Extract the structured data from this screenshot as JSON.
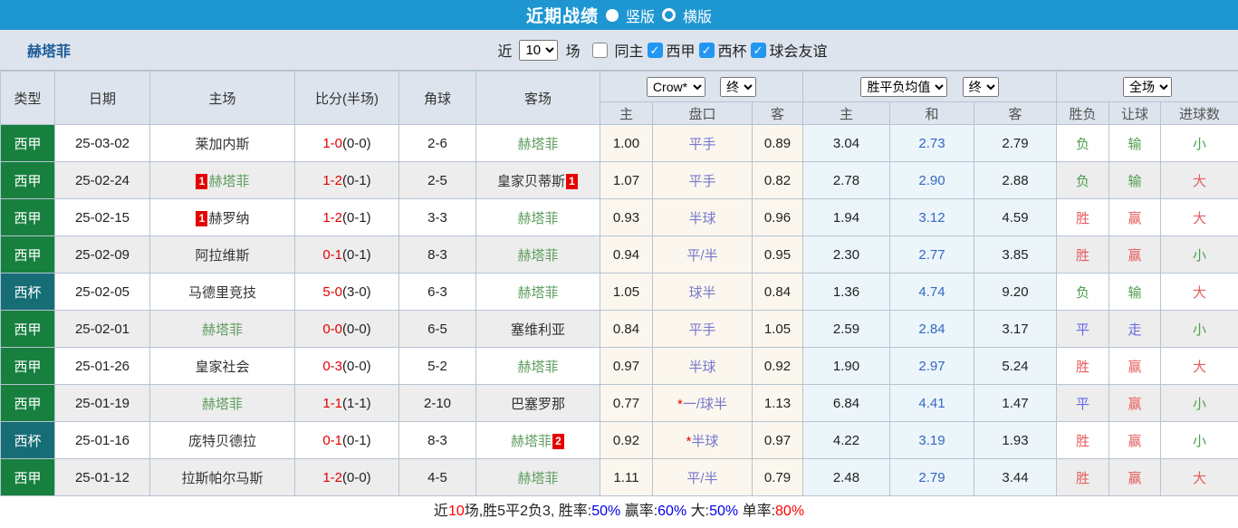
{
  "colors": {
    "topbar": "#1e96d2",
    "headerbg": "#dde4ed",
    "border": "#b6c3d1",
    "teamtitle": "#1f5c99",
    "laliga": "#17803f",
    "cup": "#166d76",
    "teamgreen": "#5f9e60",
    "scorered": "#e60000",
    "handicap": "#7777cc",
    "avgblue": "#3468c0",
    "resred": "#e85c5c",
    "resgreen": "#4f9e4f",
    "resblue": "#6666e6",
    "roweven": "#ededed",
    "oddsbg": "#fbf7ee",
    "avgbg": "#ecf5fa",
    "pctblue": "#0000e6",
    "footred": "#ff0000",
    "check": "#2196f3"
  },
  "topbar": {
    "title": "近期战绩",
    "radio_vertical": "竖版",
    "radio_horizontal": "横版",
    "selected": "竖版"
  },
  "filter": {
    "team": "赫塔菲",
    "recent_label": "近",
    "recent_value": "10",
    "matches_label": "场",
    "same_home_label": "同主",
    "same_home_checked": false,
    "leagues": [
      {
        "label": "西甲",
        "checked": true
      },
      {
        "label": "西杯",
        "checked": true
      },
      {
        "label": "球会友谊",
        "checked": true
      }
    ]
  },
  "table": {
    "left_headers": [
      "类型",
      "日期",
      "主场",
      "比分(半场)",
      "角球",
      "客场"
    ],
    "sub_headers": [
      "主",
      "盘口",
      "客",
      "主",
      "和",
      "客",
      "胜负",
      "让球",
      "进球数"
    ],
    "bookmaker_select": "Crow*",
    "bookmaker_time_select": "终",
    "avg_select": "胜平负均值",
    "avg_time_select": "终",
    "scope_select": "全场"
  },
  "rows": [
    {
      "league": "西甲",
      "league_style": "laliga",
      "date": "25-03-02",
      "home": {
        "name": "莱加内斯",
        "green": false
      },
      "ft": "1-0",
      "ht": "(0-0)",
      "corner": "2-6",
      "away": {
        "name": "赫塔菲",
        "green": true
      },
      "crown": [
        "1.00",
        "平手",
        "0.89"
      ],
      "avg": [
        "3.04",
        "2.73",
        "2.79"
      ],
      "results": [
        {
          "t": "负",
          "c": "green"
        },
        {
          "t": "输",
          "c": "green"
        },
        {
          "t": "小",
          "c": "green"
        }
      ]
    },
    {
      "league": "西甲",
      "league_style": "laliga",
      "date": "25-02-24",
      "home": {
        "name": "赫塔菲",
        "green": true,
        "badge_before": "1"
      },
      "ft": "1-2",
      "ht": "(0-1)",
      "corner": "2-5",
      "away": {
        "name": "皇家贝蒂斯",
        "green": false,
        "badge_after": "1"
      },
      "crown": [
        "1.07",
        "平手",
        "0.82"
      ],
      "avg": [
        "2.78",
        "2.90",
        "2.88"
      ],
      "results": [
        {
          "t": "负",
          "c": "green"
        },
        {
          "t": "输",
          "c": "green"
        },
        {
          "t": "大",
          "c": "red"
        }
      ]
    },
    {
      "league": "西甲",
      "league_style": "laliga",
      "date": "25-02-15",
      "home": {
        "name": "赫罗纳",
        "green": false,
        "badge_before": "1"
      },
      "ft": "1-2",
      "ht": "(0-1)",
      "corner": "3-3",
      "away": {
        "name": "赫塔菲",
        "green": true
      },
      "crown": [
        "0.93",
        "半球",
        "0.96"
      ],
      "avg": [
        "1.94",
        "3.12",
        "4.59"
      ],
      "results": [
        {
          "t": "胜",
          "c": "red"
        },
        {
          "t": "赢",
          "c": "red"
        },
        {
          "t": "大",
          "c": "red"
        }
      ]
    },
    {
      "league": "西甲",
      "league_style": "laliga",
      "date": "25-02-09",
      "home": {
        "name": "阿拉维斯",
        "green": false
      },
      "ft": "0-1",
      "ht": "(0-1)",
      "corner": "8-3",
      "away": {
        "name": "赫塔菲",
        "green": true
      },
      "crown": [
        "0.94",
        "平/半",
        "0.95"
      ],
      "avg": [
        "2.30",
        "2.77",
        "3.85"
      ],
      "results": [
        {
          "t": "胜",
          "c": "red"
        },
        {
          "t": "赢",
          "c": "red"
        },
        {
          "t": "小",
          "c": "green"
        }
      ]
    },
    {
      "league": "西杯",
      "league_style": "cup",
      "date": "25-02-05",
      "home": {
        "name": "马德里竞技",
        "green": false
      },
      "ft": "5-0",
      "ht": "(3-0)",
      "corner": "6-3",
      "away": {
        "name": "赫塔菲",
        "green": true
      },
      "crown": [
        "1.05",
        "球半",
        "0.84"
      ],
      "avg": [
        "1.36",
        "4.74",
        "9.20"
      ],
      "results": [
        {
          "t": "负",
          "c": "green"
        },
        {
          "t": "输",
          "c": "green"
        },
        {
          "t": "大",
          "c": "red"
        }
      ]
    },
    {
      "league": "西甲",
      "league_style": "laliga",
      "date": "25-02-01",
      "home": {
        "name": "赫塔菲",
        "green": true
      },
      "ft": "0-0",
      "ht": "(0-0)",
      "corner": "6-5",
      "away": {
        "name": "塞维利亚",
        "green": false
      },
      "crown": [
        "0.84",
        "平手",
        "1.05"
      ],
      "avg": [
        "2.59",
        "2.84",
        "3.17"
      ],
      "results": [
        {
          "t": "平",
          "c": "blue"
        },
        {
          "t": "走",
          "c": "blue"
        },
        {
          "t": "小",
          "c": "green"
        }
      ]
    },
    {
      "league": "西甲",
      "league_style": "laliga",
      "date": "25-01-26",
      "home": {
        "name": "皇家社会",
        "green": false
      },
      "ft": "0-3",
      "ht": "(0-0)",
      "corner": "5-2",
      "away": {
        "name": "赫塔菲",
        "green": true
      },
      "crown": [
        "0.97",
        "半球",
        "0.92"
      ],
      "avg": [
        "1.90",
        "2.97",
        "5.24"
      ],
      "results": [
        {
          "t": "胜",
          "c": "red"
        },
        {
          "t": "赢",
          "c": "red"
        },
        {
          "t": "大",
          "c": "red"
        }
      ]
    },
    {
      "league": "西甲",
      "league_style": "laliga",
      "date": "25-01-19",
      "home": {
        "name": "赫塔菲",
        "green": true
      },
      "ft": "1-1",
      "ht": "(1-1)",
      "corner": "2-10",
      "away": {
        "name": "巴塞罗那",
        "green": false
      },
      "crown": [
        "0.77",
        "*一/球半",
        "1.13"
      ],
      "avg": [
        "6.84",
        "4.41",
        "1.47"
      ],
      "results": [
        {
          "t": "平",
          "c": "blue"
        },
        {
          "t": "赢",
          "c": "red"
        },
        {
          "t": "小",
          "c": "green"
        }
      ]
    },
    {
      "league": "西杯",
      "league_style": "cup",
      "date": "25-01-16",
      "home": {
        "name": "庞特贝德拉",
        "green": false
      },
      "ft": "0-1",
      "ht": "(0-1)",
      "corner": "8-3",
      "away": {
        "name": "赫塔菲",
        "green": true,
        "badge_after": "2"
      },
      "crown": [
        "0.92",
        "*半球",
        "0.97"
      ],
      "avg": [
        "4.22",
        "3.19",
        "1.93"
      ],
      "results": [
        {
          "t": "胜",
          "c": "red"
        },
        {
          "t": "赢",
          "c": "red"
        },
        {
          "t": "小",
          "c": "green"
        }
      ]
    },
    {
      "league": "西甲",
      "league_style": "laliga",
      "date": "25-01-12",
      "home": {
        "name": "拉斯帕尔马斯",
        "green": false
      },
      "ft": "1-2",
      "ht": "(0-0)",
      "corner": "4-5",
      "away": {
        "name": "赫塔菲",
        "green": true
      },
      "crown": [
        "1.11",
        "平/半",
        "0.79"
      ],
      "avg": [
        "2.48",
        "2.79",
        "3.44"
      ],
      "results": [
        {
          "t": "胜",
          "c": "red"
        },
        {
          "t": "赢",
          "c": "red"
        },
        {
          "t": "大",
          "c": "red"
        }
      ]
    }
  ],
  "footer": {
    "segments": [
      {
        "t": "近",
        "c": "black"
      },
      {
        "t": "10",
        "c": "red"
      },
      {
        "t": "场,胜5平2负3, 胜率:",
        "c": "black"
      },
      {
        "t": "50%",
        "c": "blue"
      },
      {
        "t": " 赢率:",
        "c": "black"
      },
      {
        "t": "60%",
        "c": "blue"
      },
      {
        "t": " 大:",
        "c": "black"
      },
      {
        "t": "50%",
        "c": "blue"
      },
      {
        "t": " 单率:",
        "c": "black"
      },
      {
        "t": "80%",
        "c": "red"
      }
    ]
  }
}
